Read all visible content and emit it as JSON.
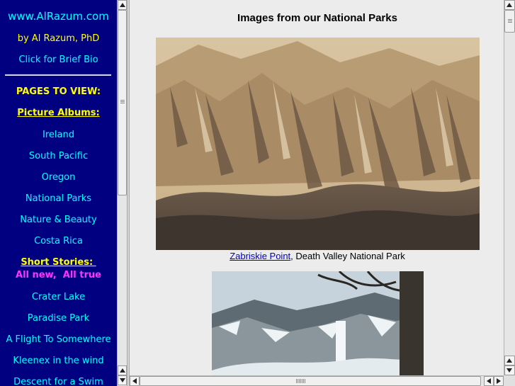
{
  "sidebar": {
    "site_name": "www.AlRazum.com",
    "author": "by Al Razum, PhD",
    "bio_link": "Click for Brief Bio",
    "pages_heading": "PAGES TO VIEW:",
    "albums_heading": "Picture Albums:",
    "albums": [
      "Ireland",
      "South Pacific",
      "Oregon",
      "National Parks",
      "Nature & Beauty",
      "Costa Rica"
    ],
    "stories_heading": "Short Stories: ",
    "stories_subheading": "All new,  All true",
    "stories": [
      "Crater Lake",
      "Paradise Park",
      "A Flight To Somewhere",
      "Kleenex in the wind",
      "Descent for a Swim"
    ]
  },
  "main": {
    "title": "Images from our National Parks",
    "photos": [
      {
        "link_text": "Zabriskie Point",
        "caption_rest": ", Death Valley National Park"
      }
    ]
  },
  "colors": {
    "sidebar_bg": "#000080",
    "sidebar_link": "#00ffff",
    "sidebar_heading": "#ffff00",
    "sidebar_subheading": "#ff33ff",
    "caption_link": "#0000cc"
  }
}
